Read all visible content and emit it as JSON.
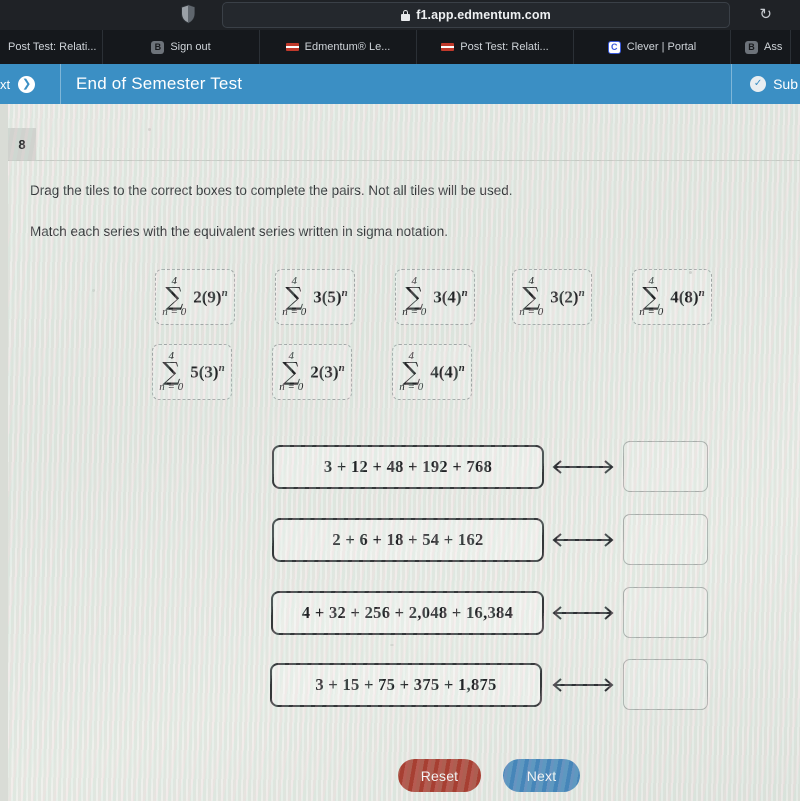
{
  "browser": {
    "url": "f1.app.edmentum.com",
    "lock_icon": "lock-icon",
    "shield_icon": "shield-icon",
    "reload_icon": "reload-icon",
    "reload_glyph": "↻",
    "tabs": [
      {
        "label": "Post Test: Relati...",
        "favicon": "none"
      },
      {
        "label": "Sign out",
        "favicon": "letter-b"
      },
      {
        "label": "Edmentum® Le...",
        "favicon": "edmentum-flag"
      },
      {
        "label": "Post Test: Relati...",
        "favicon": "edmentum-flag"
      },
      {
        "label": "Clever | Portal",
        "favicon": "letter-c"
      },
      {
        "label": "Ass",
        "favicon": "letter-b"
      }
    ],
    "favicon_letters": {
      "b": "B",
      "c": "C"
    }
  },
  "app_header": {
    "next_label": "xt",
    "next_arrow_glyph": "❯",
    "title": "End of Semester Test",
    "submit_label": "Sub",
    "check_glyph": "✓",
    "accent_color": "#3b8fc4"
  },
  "question": {
    "number": "8",
    "instruction_1": "Drag the tiles to the correct boxes to complete the pairs. Not all tiles will be used.",
    "instruction_2": "Match each series with the equivalent series written in sigma notation."
  },
  "tiles": [
    {
      "upper": "4",
      "sigma": "∑",
      "lower": "n = 0",
      "coefficient": "2",
      "base": "9",
      "exponent": "n",
      "expr": "2(9)"
    },
    {
      "upper": "4",
      "sigma": "∑",
      "lower": "n = 0",
      "coefficient": "3",
      "base": "5",
      "exponent": "n",
      "expr": "3(5)"
    },
    {
      "upper": "4",
      "sigma": "∑",
      "lower": "n = 0",
      "coefficient": "3",
      "base": "4",
      "exponent": "n",
      "expr": "3(4)"
    },
    {
      "upper": "4",
      "sigma": "∑",
      "lower": "n = 0",
      "coefficient": "3",
      "base": "2",
      "exponent": "n",
      "expr": "3(2)"
    },
    {
      "upper": "4",
      "sigma": "∑",
      "lower": "n = 0",
      "coefficient": "4",
      "base": "8",
      "exponent": "n",
      "expr": "4(8)"
    },
    {
      "upper": "4",
      "sigma": "∑",
      "lower": "n = 0",
      "coefficient": "5",
      "base": "3",
      "exponent": "n",
      "expr": "5(3)"
    },
    {
      "upper": "4",
      "sigma": "∑",
      "lower": "n = 0",
      "coefficient": "2",
      "base": "3",
      "exponent": "n",
      "expr": "2(3)"
    },
    {
      "upper": "4",
      "sigma": "∑",
      "lower": "n = 0",
      "coefficient": "4",
      "base": "4",
      "exponent": "n",
      "expr": "4(4)"
    }
  ],
  "pairs": [
    {
      "series": "3 + 12 + 48 + 192 + 768",
      "arrow": "⟷",
      "answer": ""
    },
    {
      "series": "2 + 6 + 18 + 54 + 162",
      "arrow": "⟷",
      "answer": ""
    },
    {
      "series": "4 + 32 + 256 + 2,048 + 16,384",
      "arrow": "⟷",
      "answer": ""
    },
    {
      "series": "3 + 15 + 75 + 375 + 1,875",
      "arrow": "⟷",
      "answer": ""
    }
  ],
  "footer": {
    "reset_label": "Reset",
    "next_label": "Next",
    "reset_color": "#a23527",
    "next_color": "#3c7fb5"
  }
}
